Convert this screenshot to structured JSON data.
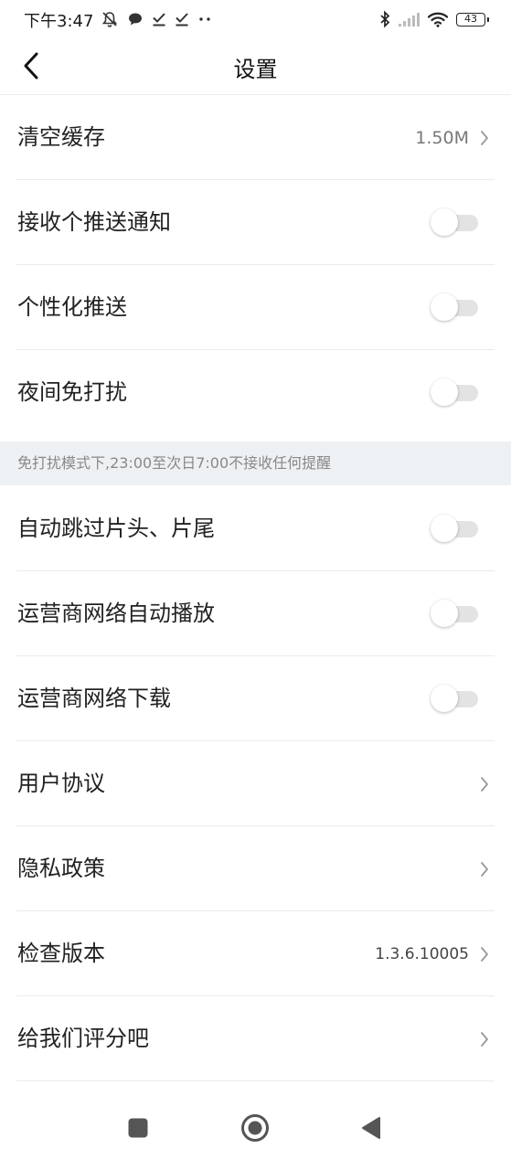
{
  "status_bar": {
    "time": "下午3:47",
    "battery": "43",
    "icons_left": [
      "mute-icon",
      "chat-icon",
      "download-done-icon",
      "download-done-icon",
      "more-dots-icon"
    ],
    "icons_right": [
      "bluetooth-icon",
      "signal-icon",
      "wifi-icon",
      "battery-icon"
    ]
  },
  "header": {
    "title": "设置",
    "back_icon": "back-arrow-icon"
  },
  "settings": {
    "clear_cache": {
      "label": "清空缓存",
      "value": "1.50M"
    },
    "push_notify": {
      "label": "接收个推送通知",
      "on": false
    },
    "personal_push": {
      "label": "个性化推送",
      "on": false
    },
    "night_dnd": {
      "label": "夜间免打扰",
      "on": false
    },
    "dnd_note": "免打扰模式下,23:00至次日7:00不接收任何提醒",
    "skip_intro": {
      "label": "自动跳过片头、片尾",
      "on": false
    },
    "carrier_autoplay": {
      "label": "运营商网络自动播放",
      "on": false
    },
    "carrier_download": {
      "label": "运营商网络下载",
      "on": false
    },
    "user_agreement": {
      "label": "用户协议"
    },
    "privacy_policy": {
      "label": "隐私政策"
    },
    "check_version": {
      "label": "检查版本",
      "value": "1.3.6.10005"
    },
    "rate_us": {
      "label": "给我们评分吧"
    }
  },
  "nav_bar": {
    "buttons": [
      "recent-apps-icon",
      "home-icon",
      "back-icon"
    ]
  },
  "colors": {
    "background": "#ffffff",
    "note_band": "#eef1f3",
    "toggle_track": "#e3e3e3",
    "divider": "#ebebeb"
  }
}
